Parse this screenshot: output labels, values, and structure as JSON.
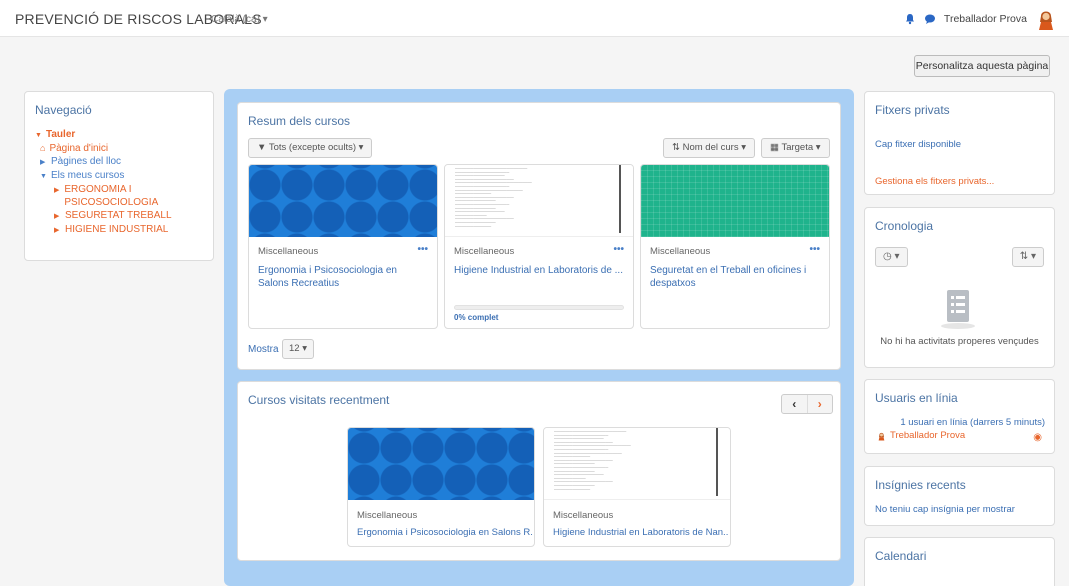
{
  "navbar": {
    "brand": "PREVENCIÓ DE RISCOS LABORALS",
    "language": "Català (ca) ▾",
    "username": "Treballador Prova"
  },
  "customize_button": "Personalitza aquesta pàgina",
  "navigation": {
    "title": "Navegació",
    "root": "Tauler",
    "home": "Pàgina d'inici",
    "site_pages": "Pàgines del lloc",
    "my_courses": "Els meus cursos",
    "courses": [
      "ERGONOMIA I PSICOSOCIOLOGIA",
      "SEGURETAT TREBALL",
      "HIGIENE INDUSTRIAL"
    ]
  },
  "overview": {
    "title": "Resum dels cursos",
    "filter": "Tots (excepte ocults) ▾",
    "sort": "Nom del curs ▾",
    "view": "Targeta ▾",
    "courses": [
      {
        "category": "Miscellaneous",
        "name": "Ergonomia i Psicosociologia en Salons Recreatius"
      },
      {
        "category": "Miscellaneous",
        "name": "Higiene Industrial en Laboratoris de ...",
        "progress_label": "0% complet",
        "progress": 0
      },
      {
        "category": "Miscellaneous",
        "name": "Seguretat en el Treball en oficines i despatxos"
      }
    ],
    "show_label": "Mostra",
    "show_value": "12 ▾"
  },
  "recent": {
    "title": "Cursos visitats recentment",
    "courses": [
      {
        "category": "Miscellaneous",
        "name": "Ergonomia i Psicosociologia en Salons R..."
      },
      {
        "category": "Miscellaneous",
        "name": "Higiene Industrial en Laboratoris de Nan..."
      }
    ]
  },
  "private_files": {
    "title": "Fitxers privats",
    "empty": "Cap fitxer disponible",
    "manage": "Gestiona els fitxers privats..."
  },
  "timeline": {
    "title": "Cronologia",
    "empty": "No hi ha activitats properes vençudes"
  },
  "online_users": {
    "title": "Usuaris en línia",
    "count": "1 usuari en línia (darrers 5 minuts)",
    "user": "Treballador Prova"
  },
  "badges": {
    "title": "Insígnies recents",
    "empty": "No teniu cap insígnia per mostrar"
  },
  "calendar": {
    "title": "Calendari"
  },
  "colors": {
    "accent_orange": "#e8662d",
    "link_blue": "#3b6fb3",
    "region_blue": "#a9cff4"
  }
}
